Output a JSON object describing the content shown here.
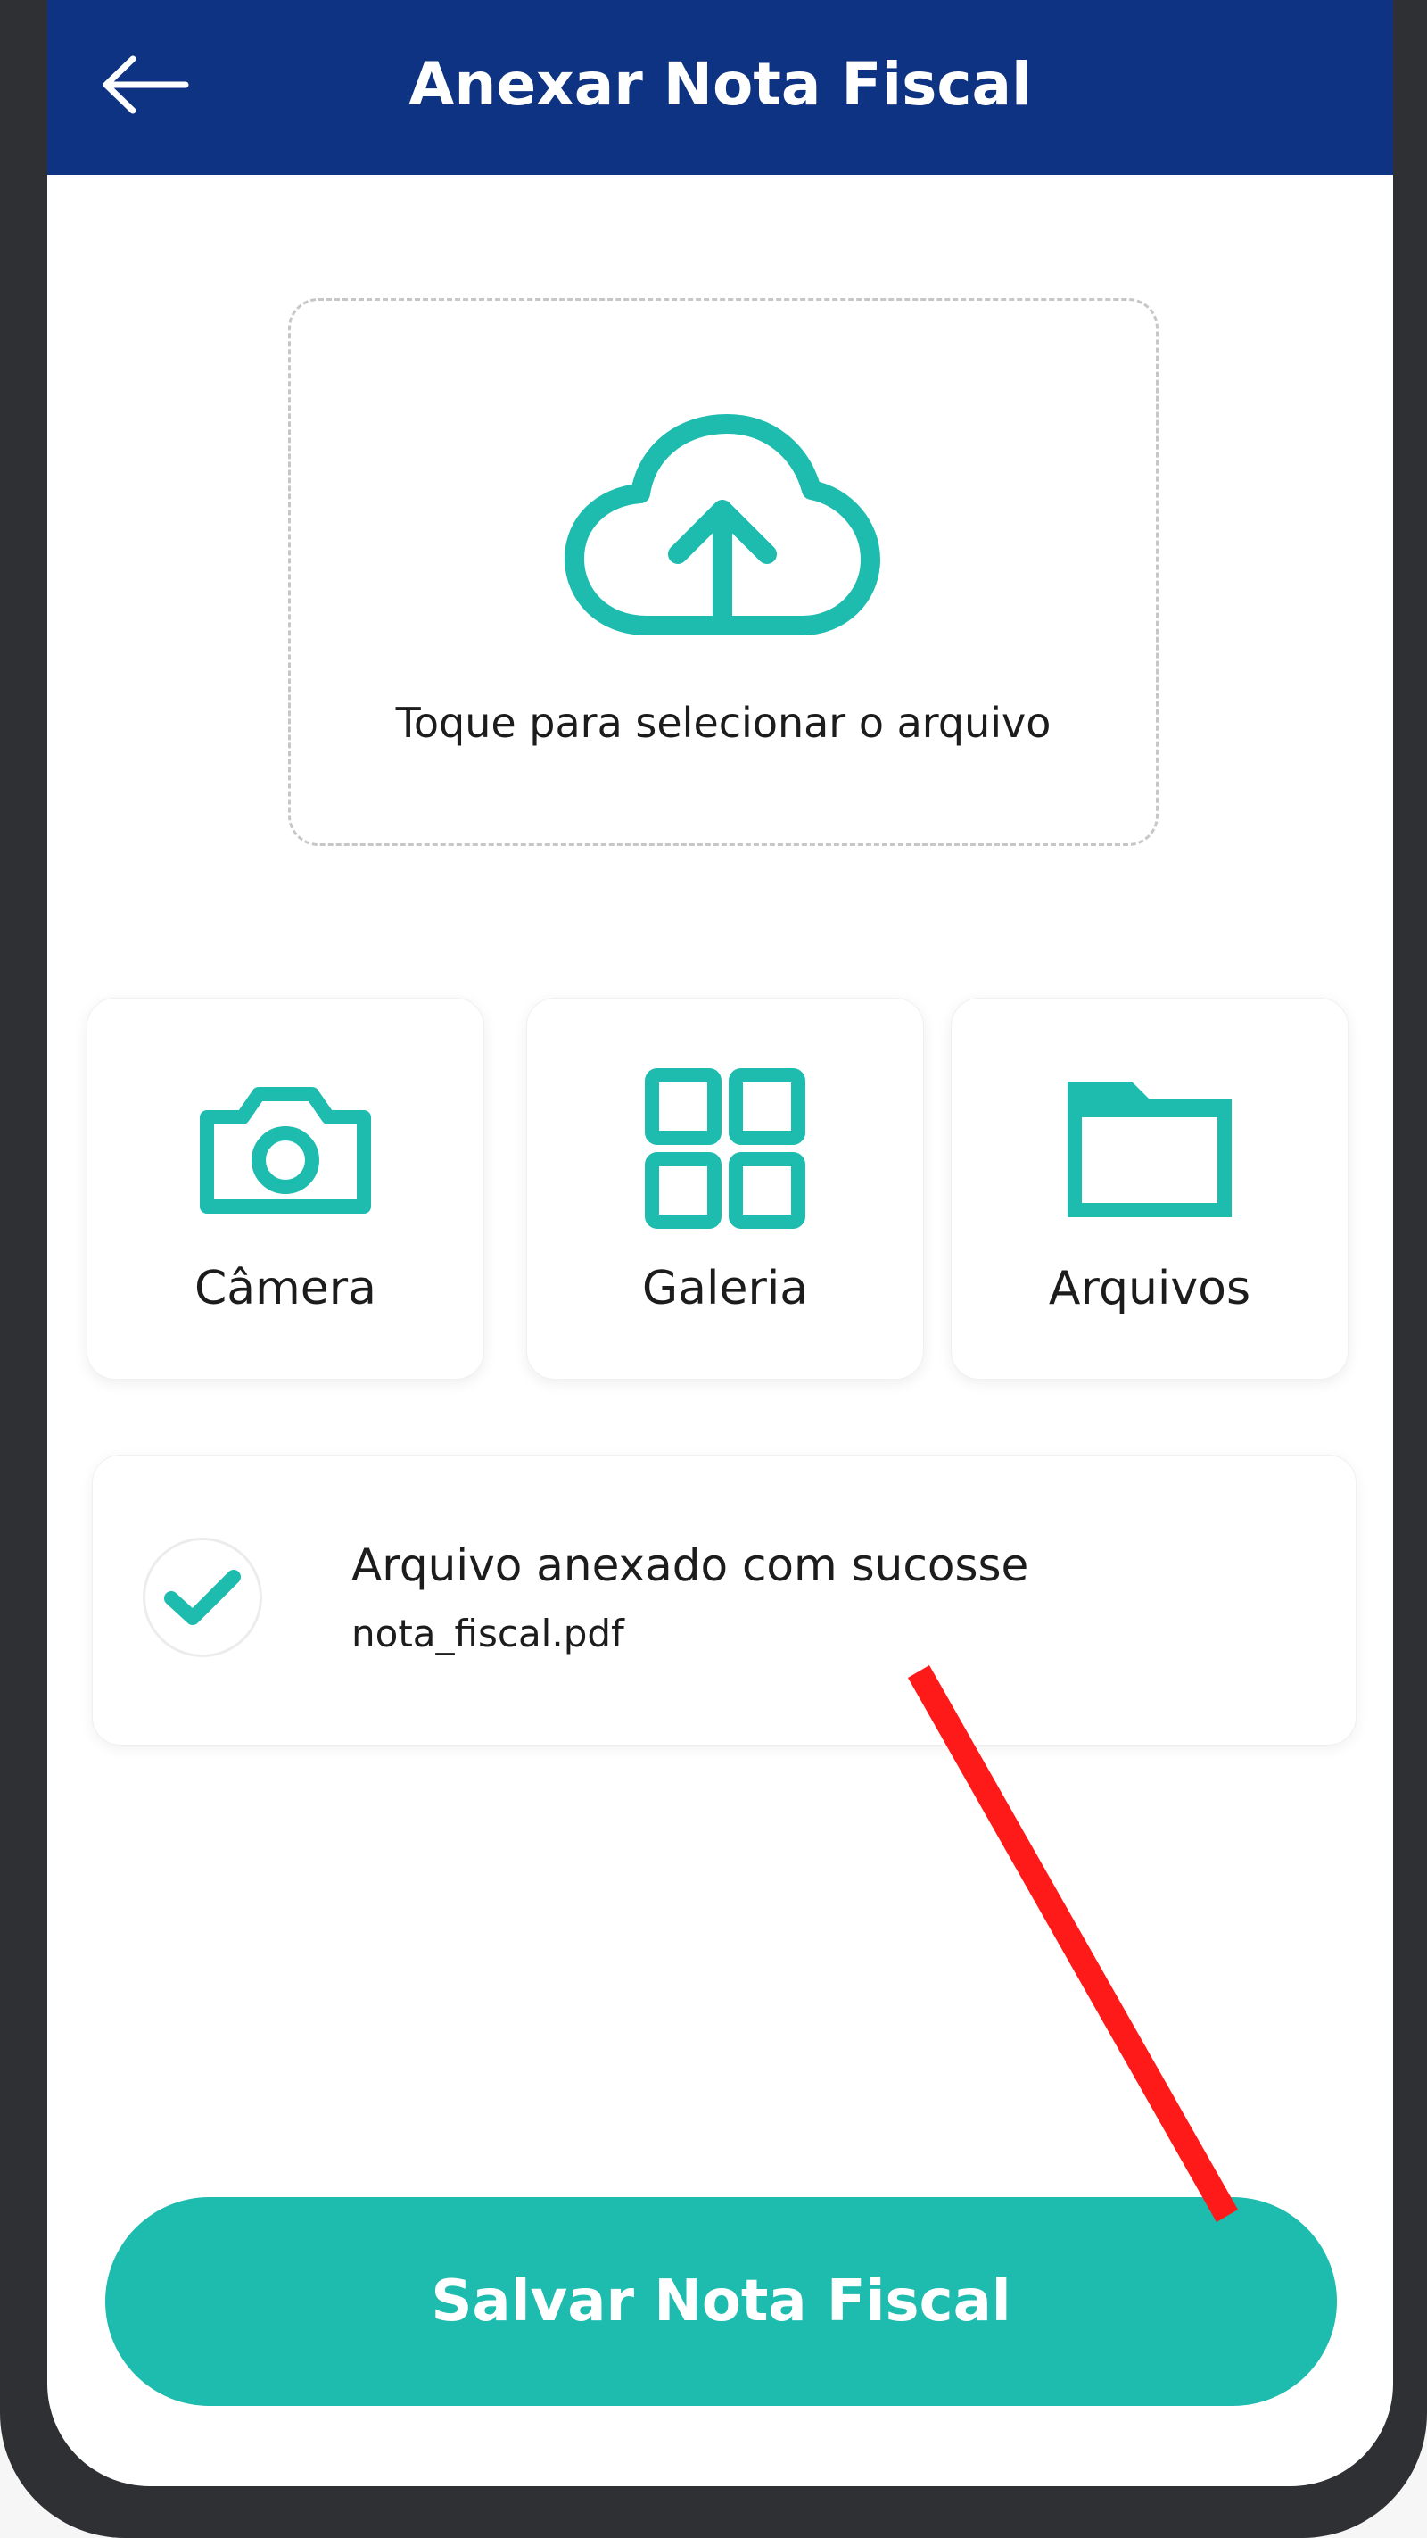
{
  "header": {
    "title": "Anexar Nota Fiscal",
    "back_icon": "arrow-left-icon"
  },
  "upload": {
    "icon": "cloud-upload-icon",
    "label": "Toque para selecionar o arquivo"
  },
  "sources": [
    {
      "label": "Câmera",
      "icon": "camera-icon"
    },
    {
      "label": "Galeria",
      "icon": "grid-icon"
    },
    {
      "label": "Arquivos",
      "icon": "folder-icon"
    }
  ],
  "status": {
    "icon": "check-icon",
    "title": "Arquivo anexado com sucosse",
    "filename": "nota_fiscal.pdf"
  },
  "footer": {
    "save_label": "Salvar Nota Fiscal"
  },
  "colors": {
    "header_bg": "#0e3382",
    "accent": "#1dbcae",
    "annotation": "#ff1a1a",
    "frame": "#2f3033"
  }
}
